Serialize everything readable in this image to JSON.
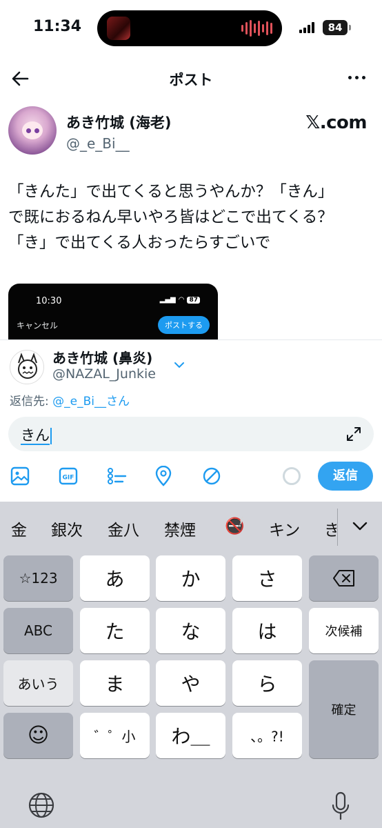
{
  "status_bar": {
    "time": "11:34",
    "battery": "84"
  },
  "header": {
    "title": "ポスト"
  },
  "post": {
    "author_name": "あき竹城 (海老)",
    "author_handle": "@_e_Bi__",
    "source_label": "𝕏.com",
    "text_lines": [
      "「きんた」で出てくると思うやんか？「きん」",
      "で既におるねん早いやろ皆はどこで出てくる？",
      "「き」で出てくる人おったらすごいで"
    ],
    "embedded_screenshot": {
      "time": "10:30",
      "battery": "87",
      "cancel_label": "キャンセル",
      "post_label": "ポストする"
    }
  },
  "composer": {
    "account_name": "あき竹城 (鼻炎)",
    "account_handle": "@NAZAL_Junkie",
    "reply_to_prefix": "返信先: ",
    "reply_to_mention": "@_e_Bi__さん",
    "input_text": "きん",
    "reply_button": "返信",
    "toolbar_icons": [
      "image-icon",
      "gif-icon",
      "poll-icon",
      "location-icon",
      "no-circle-icon"
    ]
  },
  "keyboard": {
    "candidates": [
      "金",
      "銀次",
      "金八",
      "禁煙",
      "🚭",
      "キン",
      "き"
    ],
    "rows": {
      "left": [
        "☆123",
        "ABC",
        "あいう",
        "☺"
      ],
      "r1": [
        "あ",
        "か",
        "さ"
      ],
      "r2": [
        "た",
        "な",
        "は"
      ],
      "r3": [
        "ま",
        "や",
        "ら"
      ],
      "r4": [
        "゛゜小",
        "わ＿",
        "、。?!"
      ],
      "next_candidate": "次候補",
      "confirm": "確定"
    },
    "colors": {
      "background": "#d3d5db",
      "key": "#ffffff",
      "dark_key": "#acb0ba"
    }
  },
  "colors": {
    "accent": "#1d9bf0",
    "text": "#0f1419",
    "secondary": "#536471"
  }
}
